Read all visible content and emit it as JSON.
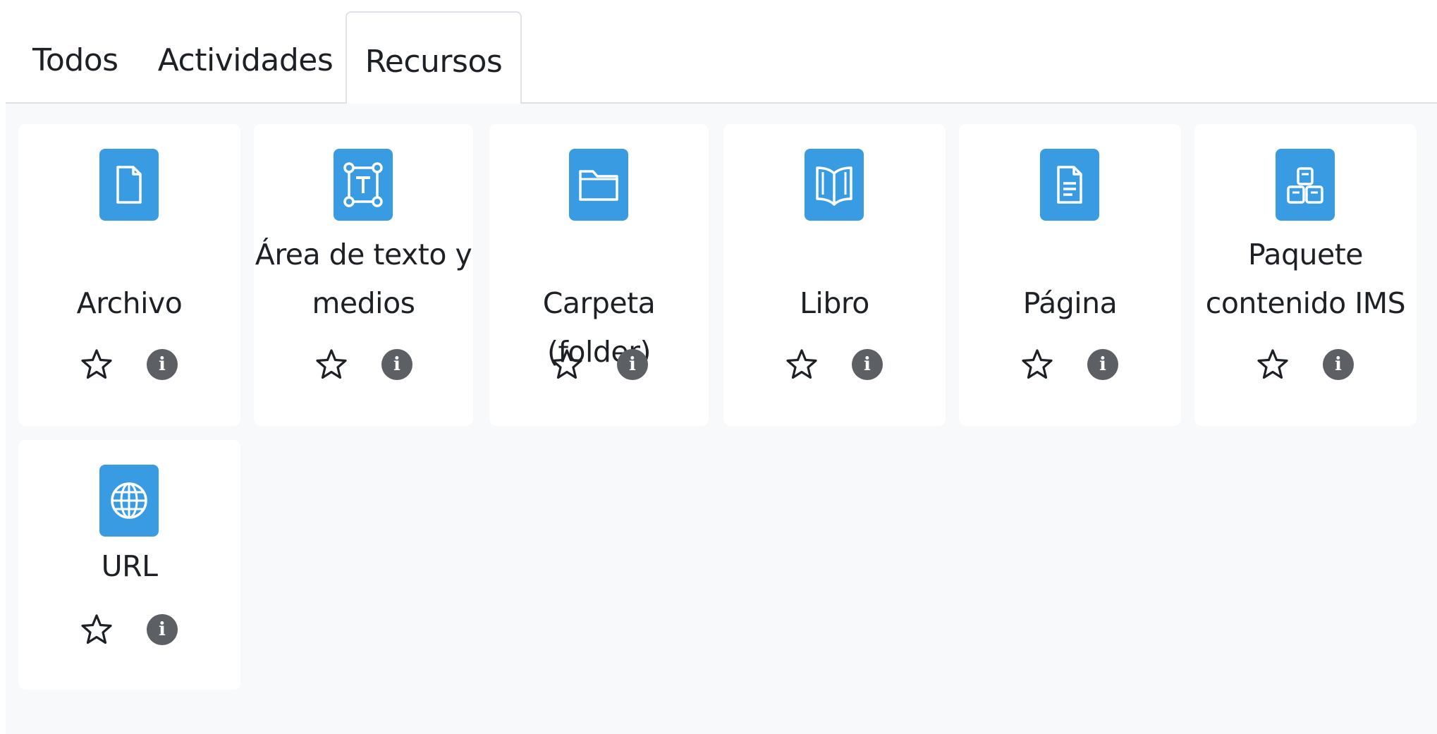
{
  "tabs": [
    {
      "label": "Todos"
    },
    {
      "label": "Actividades"
    },
    {
      "label": "Recursos",
      "active": true
    }
  ],
  "accent_color": "#399be2",
  "resources": [
    {
      "label_line1": "",
      "label_line2": "Archivo",
      "icon": "file-icon"
    },
    {
      "label_line1": "Área de texto y",
      "label_line2": "medios",
      "icon": "text-area-icon"
    },
    {
      "label_line1": "",
      "label_line2": "Carpeta (folder)",
      "icon": "folder-icon"
    },
    {
      "label_line1": "",
      "label_line2": "Libro",
      "icon": "book-icon"
    },
    {
      "label_line1": "",
      "label_line2": "Página",
      "icon": "page-icon"
    },
    {
      "label_line1": "Paquete",
      "label_line2": "contenido IMS",
      "icon": "ims-package-icon"
    },
    {
      "label_line1": "",
      "label_line2": "URL",
      "icon": "globe-icon"
    }
  ],
  "info_glyph": "i"
}
